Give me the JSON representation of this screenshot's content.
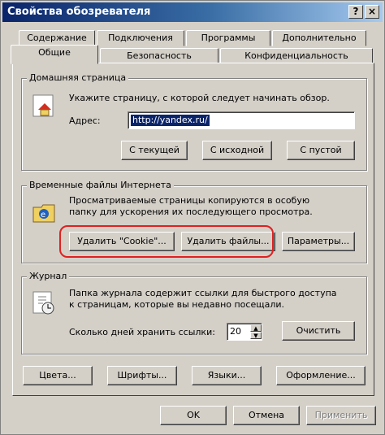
{
  "window": {
    "title": "Свойства обозревателя",
    "help": "?",
    "close": "×"
  },
  "tabs_row_back": [
    "Содержание",
    "Подключения",
    "Программы",
    "Дополнительно"
  ],
  "tabs_row_front": [
    "Общие",
    "Безопасность",
    "Конфиденциальность"
  ],
  "home": {
    "label": "Домашняя страница",
    "desc": "Укажите страницу, с которой следует начинать обзор.",
    "address_label": "Адрес:",
    "address_value": "http://yandex.ru/",
    "buttons": [
      "С текущей",
      "С исходной",
      "С пустой"
    ]
  },
  "temp": {
    "label": "Временные файлы Интернета",
    "desc1": "Просматриваемые страницы копируются в особую",
    "desc2": "папку для ускорения их последующего просмотра.",
    "buttons": [
      "Удалить \"Cookie\"...",
      "Удалить файлы...",
      "Параметры..."
    ]
  },
  "history": {
    "label": "Журнал",
    "desc1": "Папка журнала содержит ссылки для быстрого доступа",
    "desc2": "к страницам, которые вы недавно посещали.",
    "days_label": "Сколько дней хранить ссылки:",
    "days_value": "20",
    "clear": "Очистить"
  },
  "bottom_buttons": [
    "Цвета...",
    "Шрифты...",
    "Языки...",
    "Оформление..."
  ],
  "dialog_buttons": {
    "ok": "OK",
    "cancel": "Отмена",
    "apply": "Применить"
  },
  "colors": {
    "titlebar": "#0a246a",
    "face": "#d4d0c8",
    "highlight": "#e02020"
  }
}
